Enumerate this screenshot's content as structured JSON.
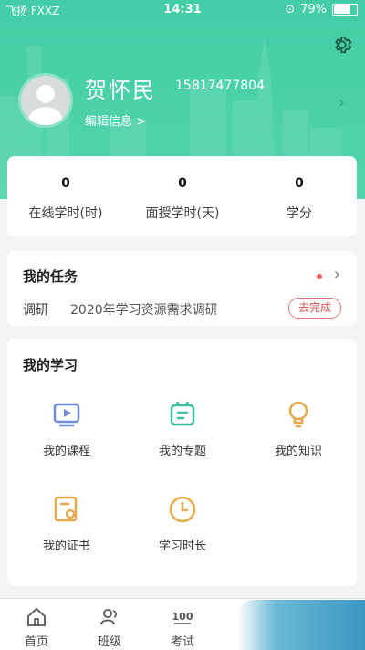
{
  "statusbar": {
    "left": "飞扬 FXXZ",
    "time": "14:31",
    "battery": "79%"
  },
  "profile": {
    "name": "贺怀民",
    "phone": "15817477804",
    "edit_label": "编辑信息 >"
  },
  "stats": [
    {
      "value": "0",
      "label": "在线学时(时)"
    },
    {
      "value": "0",
      "label": "面授学时(天)"
    },
    {
      "value": "0",
      "label": "学分"
    }
  ],
  "tasks": {
    "title": "我的任务",
    "row_type": "调研",
    "row_text": "2020年学习资源需求调研",
    "action": "去完成"
  },
  "study": {
    "title": "我的学习",
    "items": [
      {
        "label": "我的课程",
        "icon": "course-play-icon"
      },
      {
        "label": "我的专题",
        "icon": "topic-icon"
      },
      {
        "label": "我的知识",
        "icon": "lightbulb-icon"
      },
      {
        "label": "我的证书",
        "icon": "certificate-icon"
      },
      {
        "label": "学习时长",
        "icon": "clock-icon"
      }
    ]
  },
  "tabbar": [
    {
      "label": "首页",
      "icon": "home-icon"
    },
    {
      "label": "班级",
      "icon": "class-icon"
    },
    {
      "label": "考试",
      "icon": "exam-100-icon"
    }
  ],
  "colors": {
    "accent": "#43cda6",
    "danger": "#d95757"
  }
}
